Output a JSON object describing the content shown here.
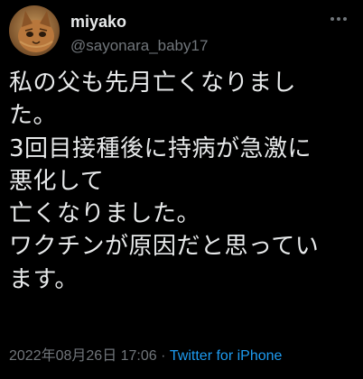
{
  "tweet": {
    "display_name": "miyako",
    "handle": "@sayonara_baby17",
    "text_lines": [
      "私の父も先月亡くなりまし",
      "た。",
      "3回目接種後に持病が急激に",
      "悪化して",
      "亡くなりました。",
      "ワクチンが原因だと思ってい",
      "ます。"
    ],
    "timestamp": "2022年08月26日 17:06",
    "separator": " · ",
    "source": "Twitter for iPhone"
  },
  "icons": {
    "more": "more-options-icon",
    "avatar": "cat-avatar"
  },
  "colors": {
    "background": "#000000",
    "text": "#e7e9ea",
    "secondary": "#71767b",
    "link": "#1d9bf0"
  }
}
